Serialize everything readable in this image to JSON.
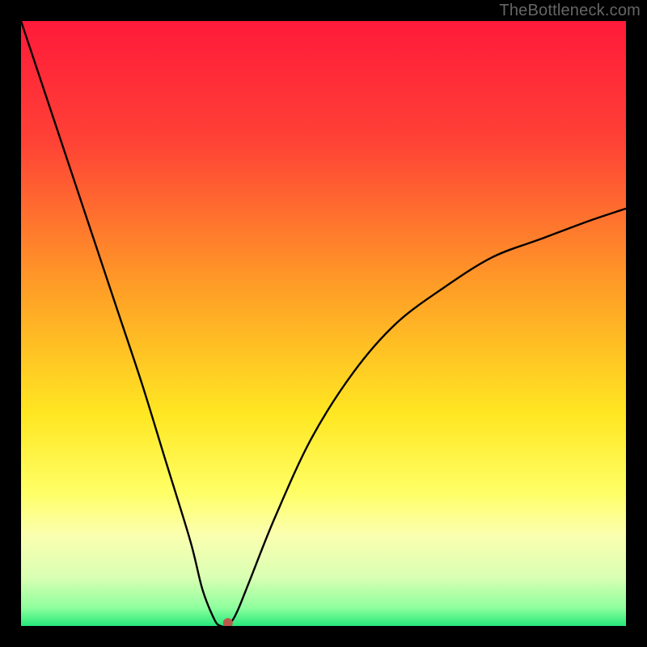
{
  "watermark": "TheBottleneck.com",
  "chart_data": {
    "type": "line",
    "title": "",
    "xlabel": "",
    "ylabel": "",
    "xlim": [
      0,
      100
    ],
    "ylim": [
      0,
      100
    ],
    "background_gradient": {
      "stops": [
        {
          "pct": 0,
          "color": "#ff1a3a"
        },
        {
          "pct": 20,
          "color": "#ff4236"
        },
        {
          "pct": 45,
          "color": "#ffa126"
        },
        {
          "pct": 65,
          "color": "#ffe722"
        },
        {
          "pct": 78,
          "color": "#ffff66"
        },
        {
          "pct": 85,
          "color": "#fbffb0"
        },
        {
          "pct": 92,
          "color": "#d9ffb3"
        },
        {
          "pct": 97,
          "color": "#8fff9e"
        },
        {
          "pct": 100,
          "color": "#26e87a"
        }
      ]
    },
    "series": [
      {
        "name": "bottleneck-curve",
        "color": "#000000",
        "x": [
          0,
          4,
          8,
          12,
          16,
          20,
          24,
          28,
          30,
          32,
          33,
          34,
          35,
          36,
          38,
          42,
          48,
          55,
          62,
          70,
          78,
          86,
          94,
          100
        ],
        "y": [
          100,
          88,
          76,
          64,
          52,
          40,
          27,
          14,
          6,
          1,
          0,
          0,
          1,
          3,
          8,
          18,
          31,
          42,
          50,
          56,
          61,
          64,
          67,
          69
        ]
      }
    ],
    "marker": {
      "x": 34.2,
      "y": 0.5,
      "color": "#b85a4a",
      "r": 6
    }
  }
}
